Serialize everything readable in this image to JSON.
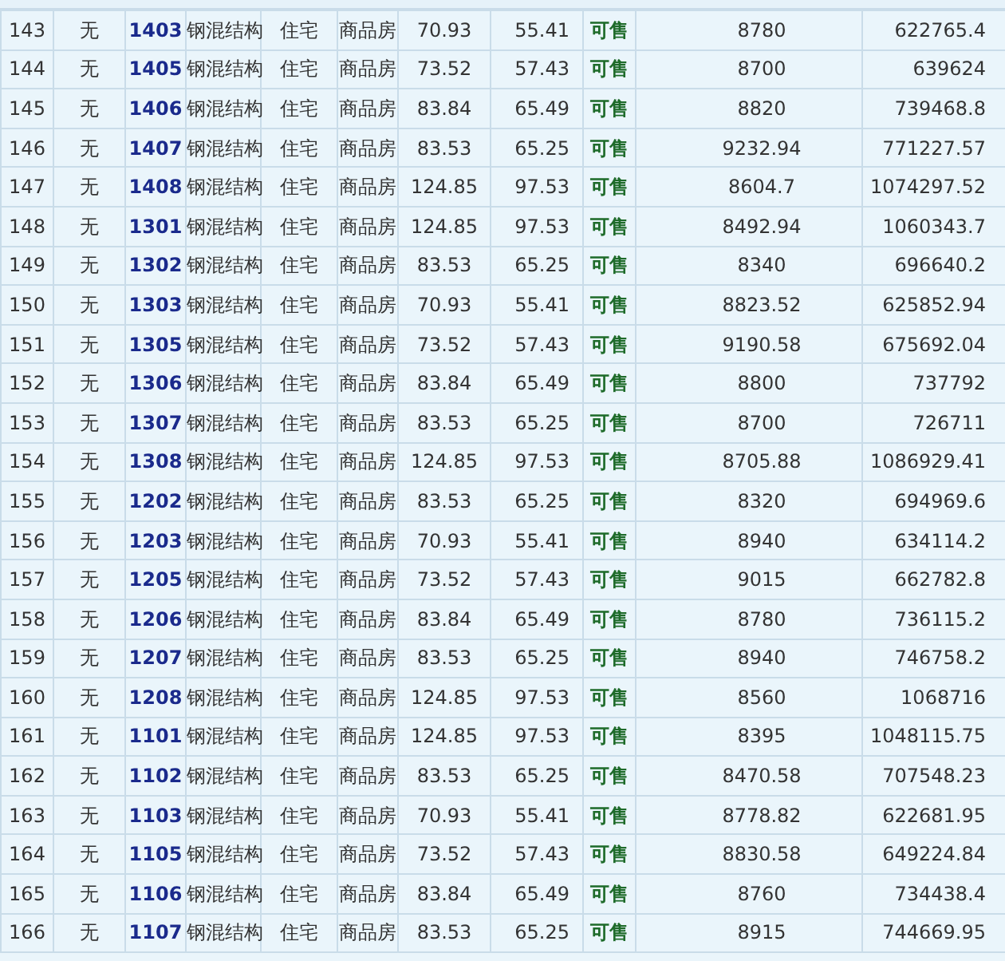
{
  "table": {
    "rows": [
      {
        "no": "143",
        "mark": "无",
        "room": "1403",
        "structure": "钢混结构",
        "use": "住宅",
        "type": "商品房",
        "area": "70.93",
        "inner_area": "55.41",
        "status": "可售",
        "unit_price": "8780",
        "total_price": "622765.4"
      },
      {
        "no": "144",
        "mark": "无",
        "room": "1405",
        "structure": "钢混结构",
        "use": "住宅",
        "type": "商品房",
        "area": "73.52",
        "inner_area": "57.43",
        "status": "可售",
        "unit_price": "8700",
        "total_price": "639624"
      },
      {
        "no": "145",
        "mark": "无",
        "room": "1406",
        "structure": "钢混结构",
        "use": "住宅",
        "type": "商品房",
        "area": "83.84",
        "inner_area": "65.49",
        "status": "可售",
        "unit_price": "8820",
        "total_price": "739468.8"
      },
      {
        "no": "146",
        "mark": "无",
        "room": "1407",
        "structure": "钢混结构",
        "use": "住宅",
        "type": "商品房",
        "area": "83.53",
        "inner_area": "65.25",
        "status": "可售",
        "unit_price": "9232.94",
        "total_price": "771227.57"
      },
      {
        "no": "147",
        "mark": "无",
        "room": "1408",
        "structure": "钢混结构",
        "use": "住宅",
        "type": "商品房",
        "area": "124.85",
        "inner_area": "97.53",
        "status": "可售",
        "unit_price": "8604.7",
        "total_price": "1074297.52"
      },
      {
        "no": "148",
        "mark": "无",
        "room": "1301",
        "structure": "钢混结构",
        "use": "住宅",
        "type": "商品房",
        "area": "124.85",
        "inner_area": "97.53",
        "status": "可售",
        "unit_price": "8492.94",
        "total_price": "1060343.7"
      },
      {
        "no": "149",
        "mark": "无",
        "room": "1302",
        "structure": "钢混结构",
        "use": "住宅",
        "type": "商品房",
        "area": "83.53",
        "inner_area": "65.25",
        "status": "可售",
        "unit_price": "8340",
        "total_price": "696640.2"
      },
      {
        "no": "150",
        "mark": "无",
        "room": "1303",
        "structure": "钢混结构",
        "use": "住宅",
        "type": "商品房",
        "area": "70.93",
        "inner_area": "55.41",
        "status": "可售",
        "unit_price": "8823.52",
        "total_price": "625852.94"
      },
      {
        "no": "151",
        "mark": "无",
        "room": "1305",
        "structure": "钢混结构",
        "use": "住宅",
        "type": "商品房",
        "area": "73.52",
        "inner_area": "57.43",
        "status": "可售",
        "unit_price": "9190.58",
        "total_price": "675692.04"
      },
      {
        "no": "152",
        "mark": "无",
        "room": "1306",
        "structure": "钢混结构",
        "use": "住宅",
        "type": "商品房",
        "area": "83.84",
        "inner_area": "65.49",
        "status": "可售",
        "unit_price": "8800",
        "total_price": "737792"
      },
      {
        "no": "153",
        "mark": "无",
        "room": "1307",
        "structure": "钢混结构",
        "use": "住宅",
        "type": "商品房",
        "area": "83.53",
        "inner_area": "65.25",
        "status": "可售",
        "unit_price": "8700",
        "total_price": "726711"
      },
      {
        "no": "154",
        "mark": "无",
        "room": "1308",
        "structure": "钢混结构",
        "use": "住宅",
        "type": "商品房",
        "area": "124.85",
        "inner_area": "97.53",
        "status": "可售",
        "unit_price": "8705.88",
        "total_price": "1086929.41"
      },
      {
        "no": "155",
        "mark": "无",
        "room": "1202",
        "structure": "钢混结构",
        "use": "住宅",
        "type": "商品房",
        "area": "83.53",
        "inner_area": "65.25",
        "status": "可售",
        "unit_price": "8320",
        "total_price": "694969.6"
      },
      {
        "no": "156",
        "mark": "无",
        "room": "1203",
        "structure": "钢混结构",
        "use": "住宅",
        "type": "商品房",
        "area": "70.93",
        "inner_area": "55.41",
        "status": "可售",
        "unit_price": "8940",
        "total_price": "634114.2"
      },
      {
        "no": "157",
        "mark": "无",
        "room": "1205",
        "structure": "钢混结构",
        "use": "住宅",
        "type": "商品房",
        "area": "73.52",
        "inner_area": "57.43",
        "status": "可售",
        "unit_price": "9015",
        "total_price": "662782.8"
      },
      {
        "no": "158",
        "mark": "无",
        "room": "1206",
        "structure": "钢混结构",
        "use": "住宅",
        "type": "商品房",
        "area": "83.84",
        "inner_area": "65.49",
        "status": "可售",
        "unit_price": "8780",
        "total_price": "736115.2"
      },
      {
        "no": "159",
        "mark": "无",
        "room": "1207",
        "structure": "钢混结构",
        "use": "住宅",
        "type": "商品房",
        "area": "83.53",
        "inner_area": "65.25",
        "status": "可售",
        "unit_price": "8940",
        "total_price": "746758.2"
      },
      {
        "no": "160",
        "mark": "无",
        "room": "1208",
        "structure": "钢混结构",
        "use": "住宅",
        "type": "商品房",
        "area": "124.85",
        "inner_area": "97.53",
        "status": "可售",
        "unit_price": "8560",
        "total_price": "1068716"
      },
      {
        "no": "161",
        "mark": "无",
        "room": "1101",
        "structure": "钢混结构",
        "use": "住宅",
        "type": "商品房",
        "area": "124.85",
        "inner_area": "97.53",
        "status": "可售",
        "unit_price": "8395",
        "total_price": "1048115.75"
      },
      {
        "no": "162",
        "mark": "无",
        "room": "1102",
        "structure": "钢混结构",
        "use": "住宅",
        "type": "商品房",
        "area": "83.53",
        "inner_area": "65.25",
        "status": "可售",
        "unit_price": "8470.58",
        "total_price": "707548.23"
      },
      {
        "no": "163",
        "mark": "无",
        "room": "1103",
        "structure": "钢混结构",
        "use": "住宅",
        "type": "商品房",
        "area": "70.93",
        "inner_area": "55.41",
        "status": "可售",
        "unit_price": "8778.82",
        "total_price": "622681.95"
      },
      {
        "no": "164",
        "mark": "无",
        "room": "1105",
        "structure": "钢混结构",
        "use": "住宅",
        "type": "商品房",
        "area": "73.52",
        "inner_area": "57.43",
        "status": "可售",
        "unit_price": "8830.58",
        "total_price": "649224.84"
      },
      {
        "no": "165",
        "mark": "无",
        "room": "1106",
        "structure": "钢混结构",
        "use": "住宅",
        "type": "商品房",
        "area": "83.84",
        "inner_area": "65.49",
        "status": "可售",
        "unit_price": "8760",
        "total_price": "734438.4"
      },
      {
        "no": "166",
        "mark": "无",
        "room": "1107",
        "structure": "钢混结构",
        "use": "住宅",
        "type": "商品房",
        "area": "83.53",
        "inner_area": "65.25",
        "status": "可售",
        "unit_price": "8915",
        "total_price": "744669.95"
      }
    ]
  }
}
